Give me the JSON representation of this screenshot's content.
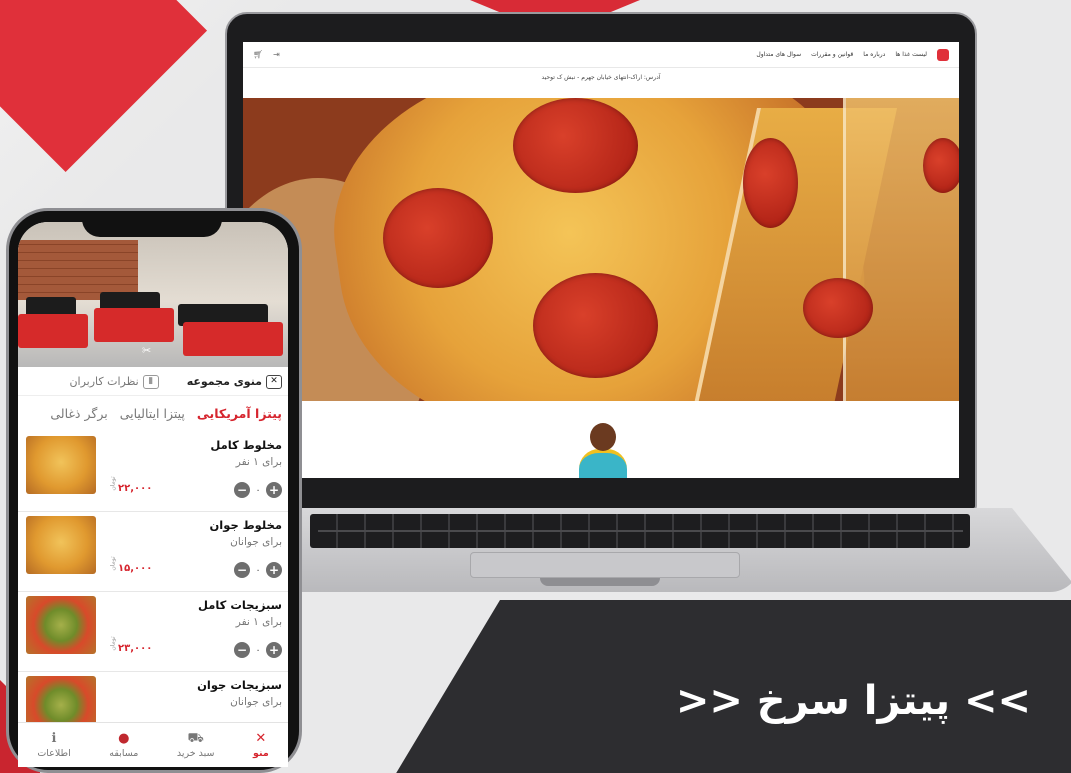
{
  "laptop_site": {
    "nav": [
      "لیست غذا ها",
      "درباره ما",
      "قوانین و مقررات",
      "سوال های متداول"
    ],
    "address": "آدرس: اراک-انتهای خیابان جهرم - نبش ک توحید",
    "cart_icon": "cart-icon",
    "login_icon": "login-icon"
  },
  "phone_app": {
    "tabs": {
      "menu_collection": "منوی مجموعه",
      "user_reviews": "نظرات کاربران"
    },
    "categories": [
      "پیتزا آمریکایی",
      "پیتزا ایتالیایی",
      "برگر ذغالی"
    ],
    "active_category_index": 0,
    "items": [
      {
        "name": "مخلوط کامل",
        "desc": "برای ۱ نفر",
        "price": "۲۲,۰۰۰",
        "unit": "تومان",
        "qty": "۰",
        "thumb": "pizza"
      },
      {
        "name": "مخلوط جوان",
        "desc": "برای جوانان",
        "price": "۱۵,۰۰۰",
        "unit": "تومان",
        "qty": "۰",
        "thumb": "pizza"
      },
      {
        "name": "سبزیجات کامل",
        "desc": "برای ۱ نفر",
        "price": "۲۳,۰۰۰",
        "unit": "تومان",
        "qty": "۰",
        "thumb": "veg"
      },
      {
        "name": "سبزیجات جوان",
        "desc": "برای جوانان",
        "price": "",
        "unit": "",
        "qty": "",
        "thumb": "veg"
      }
    ],
    "bottom_nav": [
      {
        "label": "منو",
        "icon": "fork-knife-icon",
        "glyph": "✕",
        "active": true
      },
      {
        "label": "سبد خرید",
        "icon": "cart-icon",
        "glyph": "🛒",
        "active": false
      },
      {
        "label": "مسابقه",
        "icon": "competition-icon",
        "glyph": "●",
        "active": false
      },
      {
        "label": "اطلاعات",
        "icon": "info-icon",
        "glyph": "ℹ",
        "active": false
      }
    ]
  },
  "promo": {
    "headline": ">> پیتزا سرخ <<"
  },
  "colors": {
    "brand_red": "#d6252e",
    "dark_panel": "#2d2d30"
  }
}
